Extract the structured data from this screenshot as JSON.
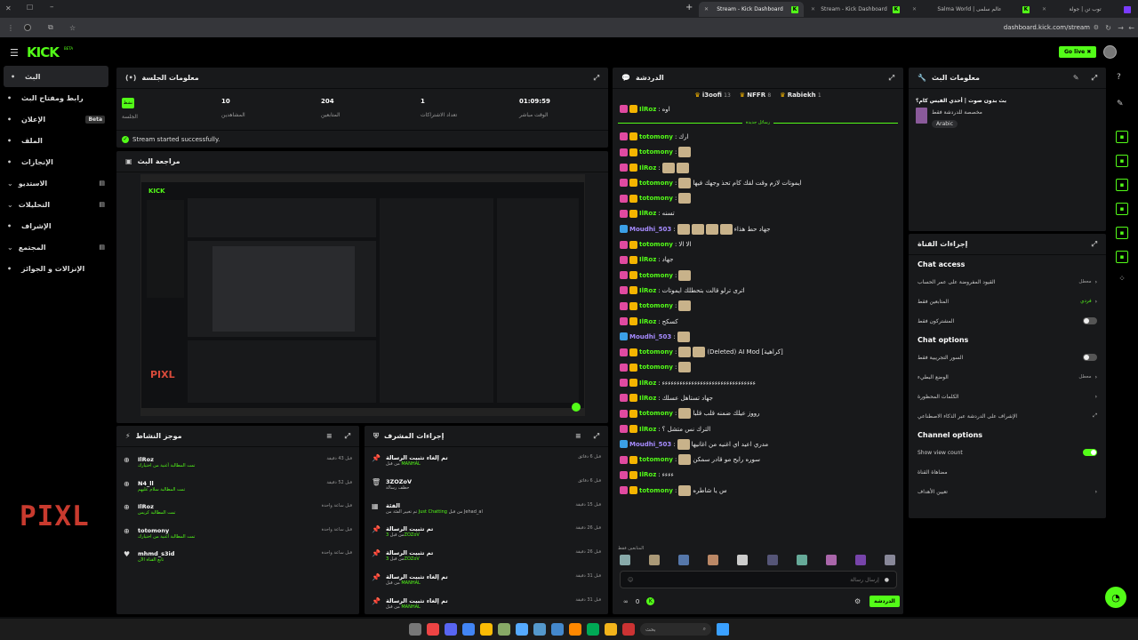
{
  "browser": {
    "tabs": [
      {
        "title": "Stream - Kick Dashboard",
        "active": true
      },
      {
        "title": "Stream - Kick Dashboard",
        "active": false
      },
      {
        "title": "Salma World | عالم سلمى",
        "active": false
      },
      {
        "title": "توب تن | جولة",
        "active": false
      }
    ],
    "new_tab": "+",
    "url": "dashboard.kick.com/stream"
  },
  "topbar": {
    "logo": "KICK",
    "beta": "BETA",
    "golive": "Go live"
  },
  "sidebar": {
    "items": [
      {
        "label": "البث",
        "icon": "broadcast-icon",
        "active": true
      },
      {
        "label": "رابط ومفتاح البث",
        "icon": "link-icon"
      },
      {
        "label": "الإعلان",
        "icon": "ad-icon",
        "badge": "Beta"
      },
      {
        "label": "الملف",
        "icon": "file-icon"
      },
      {
        "label": "الإنجازات",
        "icon": "trophy-icon"
      },
      {
        "label": "الاستديو",
        "icon": "studio-icon",
        "chev": true
      },
      {
        "label": "التحليلات",
        "icon": "analytics-icon",
        "chev": true
      },
      {
        "label": "الإشراف",
        "icon": "hammer-icon"
      },
      {
        "label": "المجتمع",
        "icon": "community-icon",
        "chev": true
      },
      {
        "label": "الإنزالات و الجوائز",
        "icon": "gift-icon"
      }
    ]
  },
  "session": {
    "title": "معلومات الجلسة",
    "status": "نشط",
    "status_label": "الجلسة",
    "stats": [
      {
        "value": "10",
        "label": "المشاهدين"
      },
      {
        "value": "204",
        "label": "المتابعين"
      },
      {
        "value": "1",
        "label": "تعداد الاشتراكات"
      },
      {
        "value": "01:09:59",
        "label": "الوقت مباشر"
      }
    ],
    "success": "Stream started successfully."
  },
  "preview": {
    "title": "مراجعة البث",
    "watermark": "PIXL"
  },
  "activity": {
    "title": "موجز النشاط",
    "items": [
      {
        "user": "IlRoz",
        "desc": "تمت المطالبة أغنية من اختيارك",
        "time": "قبل 43 دقيقة"
      },
      {
        "user": "N4_ll",
        "desc": "تمت المطالبة سلام عليهم",
        "time": "قبل 52 دقيقة"
      },
      {
        "user": "IlRoz",
        "desc": "تمت المطالبة كريس",
        "time": "قبل ساعة واحدة"
      },
      {
        "user": "totomony",
        "desc": "تمت المطالبة أغنية من اختيارك",
        "time": "قبل ساعة واحدة"
      },
      {
        "user": "mhmd_s3id",
        "desc": "تابع القناة الآن",
        "time": "قبل ساعة واحدة"
      }
    ]
  },
  "overlay_logo": "PIXL",
  "modactions": {
    "title": "إجراءات المشرف",
    "items": [
      {
        "title": "تم إلغاء تثبيت الرسالة",
        "by": "من قبل",
        "who": "MANHAL",
        "time": "قبل 6 دقائق",
        "icon": "unpin-icon"
      },
      {
        "title": "3ZOZoV",
        "by": "حظف رسالة",
        "who": "",
        "time": "قبل 6 دقائق",
        "icon": "trash-icon"
      },
      {
        "title": "الفئة",
        "by": "تم تغيير الفئة من",
        "who": "Just Chatting",
        "extra": "من قبل Jehad_al",
        "time": "قبل 15 دقيقة",
        "icon": "category-icon"
      },
      {
        "title": "تم تثبيت الرسالة",
        "by": "من قبل",
        "who": "3ZOZoV",
        "time": "قبل 26 دقيقة",
        "icon": "pin-icon"
      },
      {
        "title": "تم تثبيت الرسالة",
        "by": "من قبل",
        "who": "3ZOZoV",
        "time": "قبل 26 دقيقة",
        "icon": "pin-icon"
      },
      {
        "title": "تم إلغاء تثبيت الرسالة",
        "by": "من قبل",
        "who": "MANHAL",
        "time": "قبل 31 دقيقة",
        "icon": "unpin-icon"
      },
      {
        "title": "تم إلغاء تثبيت الرسالة",
        "by": "من قبل",
        "who": "MANHAL",
        "time": "قبل 31 دقيقة",
        "icon": "unpin-icon"
      }
    ]
  },
  "chat": {
    "title": "الدردشة",
    "top_gifters": [
      {
        "name": "i3oofi",
        "count": "13"
      },
      {
        "name": "NFFR",
        "count": "8"
      },
      {
        "name": "Rabiekh",
        "count": "1"
      }
    ],
    "first_line": {
      "user": "IlRoz",
      "text": "اوه"
    },
    "new_messages": "رسائل جديدة",
    "messages": [
      {
        "user": "totomony",
        "text": "ارك",
        "emotes": 0,
        "color": "#53fc18",
        "badges": [
          "#e04aa0",
          "#f4b400"
        ]
      },
      {
        "user": "totomony",
        "text": "",
        "emotes": 1,
        "color": "#53fc18",
        "badges": [
          "#e04aa0",
          "#f4b400"
        ]
      },
      {
        "user": "IlRoz",
        "text": "",
        "emotes": 2,
        "color": "#53fc18",
        "badges": [
          "#e04aa0",
          "#f4b400"
        ]
      },
      {
        "user": "totomony",
        "text": "ايموتات لازم وقت لقك كام تحذ وجهك فيها",
        "emotes": 1,
        "color": "#53fc18",
        "badges": [
          "#e04aa0",
          "#f4b400"
        ]
      },
      {
        "user": "totomony",
        "text": "",
        "emotes": 1,
        "color": "#53fc18",
        "badges": [
          "#e04aa0",
          "#f4b400"
        ]
      },
      {
        "user": "IlRoz",
        "text": "تسنه",
        "emotes": 0,
        "color": "#53fc18",
        "badges": [
          "#e04aa0",
          "#f4b400"
        ]
      },
      {
        "user": "Moudhi_503",
        "text": "جهاد حط هذاء",
        "emotes": 4,
        "color": "#a68bff",
        "badges": [
          "#3ba0e6"
        ]
      },
      {
        "user": "totomony",
        "text": "الا الا",
        "emotes": 0,
        "color": "#53fc18",
        "badges": [
          "#e04aa0",
          "#f4b400"
        ]
      },
      {
        "user": "IlRoz",
        "text": "جهاد",
        "emotes": 0,
        "color": "#53fc18",
        "badges": [
          "#e04aa0",
          "#f4b400"
        ]
      },
      {
        "user": "totomony",
        "text": "",
        "emotes": 1,
        "color": "#53fc18",
        "badges": [
          "#e04aa0",
          "#f4b400"
        ]
      },
      {
        "user": "IlRoz",
        "text": "اترى ترلو قالت بتحطلك ايموتات",
        "emotes": 0,
        "color": "#53fc18",
        "badges": [
          "#e04aa0",
          "#f4b400"
        ]
      },
      {
        "user": "totomony",
        "text": "",
        "emotes": 1,
        "color": "#53fc18",
        "badges": [
          "#e04aa0",
          "#f4b400"
        ]
      },
      {
        "user": "IlRoz",
        "text": "كسكح",
        "emotes": 0,
        "color": "#53fc18",
        "badges": [
          "#e04aa0",
          "#f4b400"
        ]
      },
      {
        "user": "Moudhi_503",
        "text": "",
        "emotes": 1,
        "color": "#a68bff",
        "badges": [
          "#3ba0e6"
        ]
      },
      {
        "user": "totomony",
        "text": "(Deleted) AI Mod [كراهية]",
        "emotes": 2,
        "color": "#53fc18",
        "badges": [
          "#e04aa0",
          "#f4b400"
        ]
      },
      {
        "user": "totomony",
        "text": "",
        "emotes": 1,
        "color": "#53fc18",
        "badges": [
          "#e04aa0",
          "#f4b400"
        ]
      },
      {
        "user": "IlRoz",
        "text": "ءءءءءءءءءءءءءءءءءءءءءءءءءءءءءءءء",
        "emotes": 0,
        "color": "#53fc18",
        "badges": [
          "#e04aa0",
          "#f4b400"
        ]
      },
      {
        "user": "IlRoz",
        "text": "جهاد تستاهل عسلك",
        "emotes": 0,
        "color": "#53fc18",
        "badges": [
          "#e04aa0",
          "#f4b400"
        ]
      },
      {
        "user": "totomony",
        "text": "رووز عيلك ضمنه قلب قلبا",
        "emotes": 1,
        "color": "#53fc18",
        "badges": [
          "#e04aa0",
          "#f4b400"
        ]
      },
      {
        "user": "IlRoz",
        "text": "الترك نس متشل ؟",
        "emotes": 0,
        "color": "#53fc18",
        "badges": [
          "#e04aa0",
          "#f4b400"
        ]
      },
      {
        "user": "Moudhi_503",
        "text": "مدري اعيد اي اغنيه من اغانيها",
        "emotes": 1,
        "color": "#a68bff",
        "badges": [
          "#3ba0e6"
        ]
      },
      {
        "user": "totomony",
        "text": "سوره رايح مو قادر سمكن",
        "emotes": 1,
        "color": "#53fc18",
        "badges": [
          "#e04aa0",
          "#f4b400"
        ]
      },
      {
        "user": "IlRoz",
        "text": "ءءءء",
        "emotes": 0,
        "color": "#53fc18",
        "badges": [
          "#e04aa0",
          "#f4b400"
        ]
      },
      {
        "user": "totomony",
        "text": "س يا شاطره",
        "emotes": 1,
        "color": "#53fc18",
        "badges": [
          "#e04aa0",
          "#f4b400"
        ]
      }
    ],
    "viewers_label": "المتابعين فقط",
    "input_placeholder": "إرسال رسالة",
    "points": "0",
    "send": "الدردشة"
  },
  "streaminfo": {
    "title": "معلومات البث",
    "stream_title": "بث بدون صوت | أحدي الفيس كام؟",
    "category": "مخصصة للدردشة فقط",
    "language": "Arabic"
  },
  "channelactions": {
    "title": "إجراءات القناة",
    "sections": [
      {
        "heading": "Chat access",
        "rows": [
          {
            "label": "القيود المفروضة على عمر الحساب",
            "value": "معطل",
            "type": "chev"
          },
          {
            "label": "المتابعين فقط",
            "value": "فردي",
            "type": "chev",
            "green": true
          },
          {
            "label": "المشتركون فقط",
            "type": "toggle",
            "on": false
          }
        ]
      },
      {
        "heading": "Chat options",
        "rows": [
          {
            "label": "السور التجريبية فقط",
            "type": "toggle",
            "on": false
          },
          {
            "label": "الوضع البطيء",
            "value": "معطل",
            "type": "chev"
          },
          {
            "label": "الكلمات المحظورة",
            "type": "chev"
          },
          {
            "label": "الإشراف على الدردشة عبر الذكاء الاصطناعي",
            "type": "ext"
          }
        ]
      },
      {
        "heading": "Channel options",
        "rows": [
          {
            "label": "Show view count",
            "type": "toggle",
            "on": true
          },
          {
            "label": "مضاهاة القناة",
            "type": "none"
          },
          {
            "label": "تعيين الأهداف",
            "type": "chev"
          }
        ]
      }
    ]
  },
  "taskbar": {
    "search": "بحث"
  }
}
